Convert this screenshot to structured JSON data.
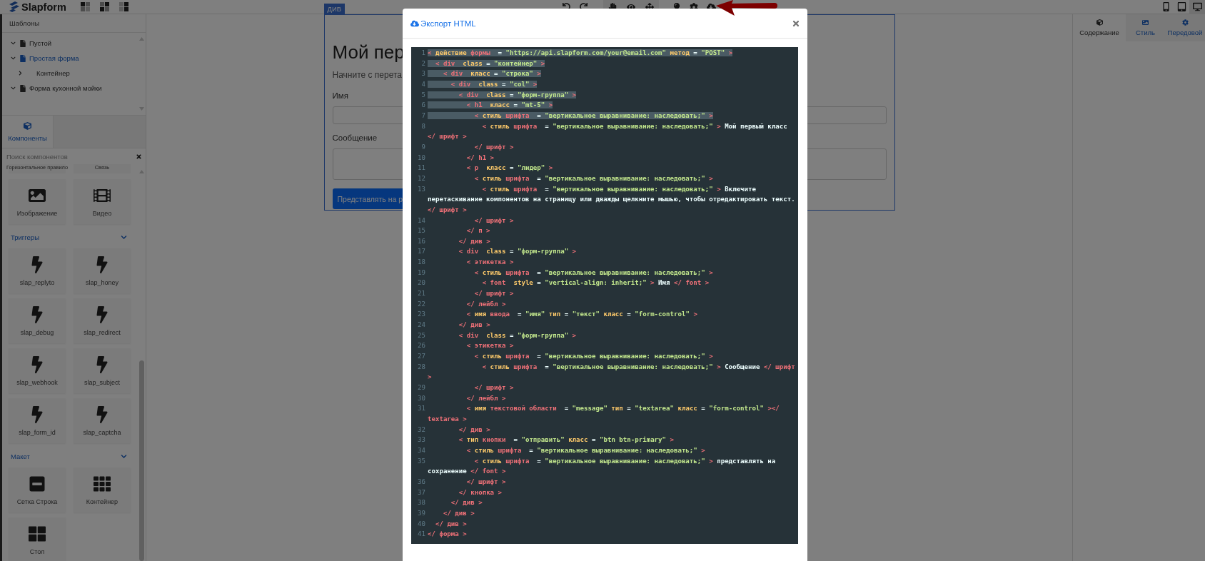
{
  "topbar": {
    "logo": "Slapform",
    "devices": [
      {
        "kind": "phone",
        "selected": false
      },
      {
        "kind": "tablet",
        "selected": false
      },
      {
        "kind": "desktop",
        "selected": true
      }
    ]
  },
  "sidebar": {
    "templates_title": "Шаблоны",
    "tree": [
      {
        "label": "Пустой",
        "expanded": true,
        "selected": false
      },
      {
        "label": "Простая форма",
        "expanded": true,
        "selected": true,
        "children": [
          {
            "label": "Контейнер",
            "expanded": false,
            "selected": false
          }
        ]
      },
      {
        "label": "Форма кухонной мойки",
        "expanded": true,
        "selected": false
      }
    ],
    "tabs": [
      {
        "label": "Компоненты",
        "selected": true
      }
    ],
    "search": {
      "placeholder": "Поиск компонентов"
    },
    "cut_blocks": [
      "Горизонтальное правило",
      "Связь"
    ],
    "blocks": [
      {
        "kind": "image",
        "label": "Изображение"
      },
      {
        "kind": "video",
        "label": "Видео"
      }
    ],
    "categories": [
      {
        "title": "Триггеры",
        "expanded": true,
        "blocks": [
          {
            "kind": "trigger",
            "label": "slap_replyto"
          },
          {
            "kind": "trigger",
            "label": "slap_honey"
          },
          {
            "kind": "trigger",
            "label": "slap_debug"
          },
          {
            "kind": "trigger",
            "label": "slap_redirect"
          },
          {
            "kind": "trigger",
            "label": "slap_webhook"
          },
          {
            "kind": "trigger",
            "label": "slap_subject"
          },
          {
            "kind": "trigger",
            "label": "slap_form_id"
          },
          {
            "kind": "trigger",
            "label": "slap_captcha"
          }
        ]
      },
      {
        "title": "Макет",
        "expanded": true,
        "blocks": [
          {
            "kind": "row",
            "label": "Сетка Строка"
          },
          {
            "kind": "grid",
            "label": "Контейнер"
          },
          {
            "kind": "table",
            "label": "Стол"
          }
        ]
      }
    ]
  },
  "canvas": {
    "badge": "ДИВ",
    "heading": "Мой пер",
    "lead": "Начните с перета",
    "fields": [
      {
        "kind": "input",
        "label": "Имя"
      },
      {
        "kind": "textarea",
        "label": "Сообщение"
      }
    ],
    "button": "Представлять на р"
  },
  "right_panel": {
    "tabs": [
      {
        "kind": "content",
        "label": "Содержание",
        "selected": true
      },
      {
        "kind": "style",
        "label": "Стиль",
        "selected": false
      },
      {
        "kind": "advanced",
        "label": "Передовой",
        "selected": false
      }
    ]
  },
  "modal": {
    "title": "Экспорт HTML",
    "code_lines": [
      {
        "number": "1",
        "highlighted": true,
        "tokens": [
          {
            "kind": "tag",
            "text": "< "
          },
          {
            "kind": "attr",
            "text": "действие"
          },
          {
            "kind": "tag",
            "text": " формы"
          },
          {
            "kind": "op",
            "text": "  = "
          },
          {
            "kind": "str",
            "text": "\"https://api.slapform.com/your@email.com\""
          },
          {
            "kind": "attr",
            "text": " метод"
          },
          {
            "kind": "op",
            "text": " = "
          },
          {
            "kind": "str",
            "text": "\"POST\""
          },
          {
            "kind": "tag",
            "text": " >"
          }
        ]
      },
      {
        "number": "2",
        "highlighted": true,
        "tokens": [
          {
            "kind": "tag",
            "text": "  < div"
          },
          {
            "kind": "attr",
            "text": "  class"
          },
          {
            "kind": "op",
            "text": " = "
          },
          {
            "kind": "str",
            "text": "\"контейнер\""
          },
          {
            "kind": "tag",
            "text": " >"
          }
        ]
      },
      {
        "number": "3",
        "highlighted": true,
        "tokens": [
          {
            "kind": "tag",
            "text": "    < div"
          },
          {
            "kind": "attr",
            "text": "  класс"
          },
          {
            "kind": "op",
            "text": " = "
          },
          {
            "kind": "str",
            "text": "\"строка\""
          },
          {
            "kind": "tag",
            "text": " >"
          }
        ]
      },
      {
        "number": "4",
        "highlighted": true,
        "tokens": [
          {
            "kind": "tag",
            "text": "      < div"
          },
          {
            "kind": "attr",
            "text": "  class"
          },
          {
            "kind": "op",
            "text": " = "
          },
          {
            "kind": "str",
            "text": "\"col\""
          },
          {
            "kind": "tag",
            "text": " >"
          }
        ]
      },
      {
        "number": "5",
        "highlighted": true,
        "tokens": [
          {
            "kind": "tag",
            "text": "        < div"
          },
          {
            "kind": "attr",
            "text": "  class"
          },
          {
            "kind": "op",
            "text": " = "
          },
          {
            "kind": "str",
            "text": "\"форм-группа\""
          },
          {
            "kind": "tag",
            "text": " >"
          }
        ]
      },
      {
        "number": "6",
        "highlighted": true,
        "tokens": [
          {
            "kind": "tag",
            "text": "          < h1"
          },
          {
            "kind": "attr",
            "text": "  класс"
          },
          {
            "kind": "op",
            "text": " = "
          },
          {
            "kind": "str",
            "text": "\"mt-5\""
          },
          {
            "kind": "tag",
            "text": " >"
          }
        ]
      },
      {
        "number": "7",
        "highlighted": true,
        "tokens": [
          {
            "kind": "tag",
            "text": "            < "
          },
          {
            "kind": "attr",
            "text": "стиль"
          },
          {
            "kind": "tag",
            "text": " шрифта"
          },
          {
            "kind": "op",
            "text": "  = "
          },
          {
            "kind": "str",
            "text": "\"вертикальное выравнивание: наследовать;\""
          },
          {
            "kind": "tag",
            "text": " >"
          }
        ]
      },
      {
        "number": "8",
        "highlighted": false,
        "tokens": [
          {
            "kind": "tag",
            "text": "              < "
          },
          {
            "kind": "attr",
            "text": "стиль"
          },
          {
            "kind": "tag",
            "text": " шрифта"
          },
          {
            "kind": "op",
            "text": "  = "
          },
          {
            "kind": "str",
            "text": "\"вертикальное выравнивание: наследовать;\""
          },
          {
            "kind": "tag",
            "text": " >"
          },
          {
            "kind": "text",
            "text": " Мой первый класс"
          },
          {
            "kind": "tag",
            "text": " </ шрифт >"
          }
        ]
      },
      {
        "number": "9",
        "highlighted": false,
        "tokens": [
          {
            "kind": "tag",
            "text": "            </ шрифт >"
          }
        ]
      },
      {
        "number": "10",
        "highlighted": false,
        "tokens": [
          {
            "kind": "tag",
            "text": "          </ h1 >"
          }
        ]
      },
      {
        "number": "11",
        "highlighted": false,
        "tokens": [
          {
            "kind": "tag",
            "text": "          < p"
          },
          {
            "kind": "attr",
            "text": "  класс"
          },
          {
            "kind": "op",
            "text": " = "
          },
          {
            "kind": "str",
            "text": "\"лидер\""
          },
          {
            "kind": "tag",
            "text": " >"
          }
        ]
      },
      {
        "number": "12",
        "highlighted": false,
        "tokens": [
          {
            "kind": "tag",
            "text": "            < "
          },
          {
            "kind": "attr",
            "text": "стиль"
          },
          {
            "kind": "tag",
            "text": " шрифта"
          },
          {
            "kind": "op",
            "text": "  = "
          },
          {
            "kind": "str",
            "text": "\"вертикальное выравнивание: наследовать;\""
          },
          {
            "kind": "tag",
            "text": " >"
          }
        ]
      },
      {
        "number": "13",
        "highlighted": false,
        "tokens": [
          {
            "kind": "tag",
            "text": "              < "
          },
          {
            "kind": "attr",
            "text": "стиль"
          },
          {
            "kind": "tag",
            "text": " шрифта"
          },
          {
            "kind": "op",
            "text": "  = "
          },
          {
            "kind": "str",
            "text": "\"вертикальное выравнивание: наследовать;\""
          },
          {
            "kind": "tag",
            "text": " >"
          },
          {
            "kind": "text",
            "text": " Включите перетаскивание компонентов на страницу или дважды щелкните мышью, чтобы отредактировать текст."
          },
          {
            "kind": "tag",
            "text": " </ шрифт >"
          }
        ]
      },
      {
        "number": "14",
        "highlighted": false,
        "tokens": [
          {
            "kind": "tag",
            "text": "            </ шрифт >"
          }
        ]
      },
      {
        "number": "15",
        "highlighted": false,
        "tokens": [
          {
            "kind": "tag",
            "text": "          </ п >"
          }
        ]
      },
      {
        "number": "16",
        "highlighted": false,
        "tokens": [
          {
            "kind": "tag",
            "text": "        </ див >"
          }
        ]
      },
      {
        "number": "17",
        "highlighted": false,
        "tokens": [
          {
            "kind": "tag",
            "text": "        < div"
          },
          {
            "kind": "attr",
            "text": "  class"
          },
          {
            "kind": "op",
            "text": " = "
          },
          {
            "kind": "str",
            "text": "\"форм-группа\""
          },
          {
            "kind": "tag",
            "text": " >"
          }
        ]
      },
      {
        "number": "18",
        "highlighted": false,
        "tokens": [
          {
            "kind": "tag",
            "text": "          < этикетка >"
          }
        ]
      },
      {
        "number": "19",
        "highlighted": false,
        "tokens": [
          {
            "kind": "tag",
            "text": "            < "
          },
          {
            "kind": "attr",
            "text": "стиль"
          },
          {
            "kind": "tag",
            "text": " шрифта"
          },
          {
            "kind": "op",
            "text": "  = "
          },
          {
            "kind": "str",
            "text": "\"вертикальное выравнивание: наследовать;\""
          },
          {
            "kind": "tag",
            "text": " >"
          }
        ]
      },
      {
        "number": "20",
        "highlighted": false,
        "tokens": [
          {
            "kind": "tag",
            "text": "              < font"
          },
          {
            "kind": "attr",
            "text": "  style"
          },
          {
            "kind": "op",
            "text": " = "
          },
          {
            "kind": "str",
            "text": "\"vertical-align: inherit;\""
          },
          {
            "kind": "tag",
            "text": " >"
          },
          {
            "kind": "text",
            "text": " Имя"
          },
          {
            "kind": "tag",
            "text": " </ font >"
          }
        ]
      },
      {
        "number": "21",
        "highlighted": false,
        "tokens": [
          {
            "kind": "tag",
            "text": "            </ шрифт >"
          }
        ]
      },
      {
        "number": "22",
        "highlighted": false,
        "tokens": [
          {
            "kind": "tag",
            "text": "          </ лейбл >"
          }
        ]
      },
      {
        "number": "23",
        "highlighted": false,
        "tokens": [
          {
            "kind": "tag",
            "text": "          < "
          },
          {
            "kind": "attr",
            "text": "имя"
          },
          {
            "kind": "tag",
            "text": " ввода"
          },
          {
            "kind": "op",
            "text": "  = "
          },
          {
            "kind": "str",
            "text": "\"имя\""
          },
          {
            "kind": "attr",
            "text": " тип"
          },
          {
            "kind": "op",
            "text": " = "
          },
          {
            "kind": "str",
            "text": "\"текст\""
          },
          {
            "kind": "attr",
            "text": " класс"
          },
          {
            "kind": "op",
            "text": " = "
          },
          {
            "kind": "str",
            "text": "\"form-control\""
          },
          {
            "kind": "tag",
            "text": " >"
          }
        ]
      },
      {
        "number": "24",
        "highlighted": false,
        "tokens": [
          {
            "kind": "tag",
            "text": "        </ див >"
          }
        ]
      },
      {
        "number": "25",
        "highlighted": false,
        "tokens": [
          {
            "kind": "tag",
            "text": "        < div"
          },
          {
            "kind": "attr",
            "text": "  class"
          },
          {
            "kind": "op",
            "text": " = "
          },
          {
            "kind": "str",
            "text": "\"форм-группа\""
          },
          {
            "kind": "tag",
            "text": " >"
          }
        ]
      },
      {
        "number": "26",
        "highlighted": false,
        "tokens": [
          {
            "kind": "tag",
            "text": "          < этикетка >"
          }
        ]
      },
      {
        "number": "27",
        "highlighted": false,
        "tokens": [
          {
            "kind": "tag",
            "text": "            < "
          },
          {
            "kind": "attr",
            "text": "стиль"
          },
          {
            "kind": "tag",
            "text": " шрифта"
          },
          {
            "kind": "op",
            "text": "  = "
          },
          {
            "kind": "str",
            "text": "\"вертикальное выравнивание: наследовать;\""
          },
          {
            "kind": "tag",
            "text": " >"
          }
        ]
      },
      {
        "number": "28",
        "highlighted": false,
        "tokens": [
          {
            "kind": "tag",
            "text": "              < "
          },
          {
            "kind": "attr",
            "text": "стиль"
          },
          {
            "kind": "tag",
            "text": " шрифта"
          },
          {
            "kind": "op",
            "text": "  = "
          },
          {
            "kind": "str",
            "text": "\"вертикальное выравнивание: наследовать;\""
          },
          {
            "kind": "tag",
            "text": " >"
          },
          {
            "kind": "text",
            "text": " Сообщение"
          },
          {
            "kind": "tag",
            "text": " </ шрифт >"
          }
        ]
      },
      {
        "number": "29",
        "highlighted": false,
        "tokens": [
          {
            "kind": "tag",
            "text": "            </ шрифт >"
          }
        ]
      },
      {
        "number": "30",
        "highlighted": false,
        "tokens": [
          {
            "kind": "tag",
            "text": "          </ лейбл >"
          }
        ]
      },
      {
        "number": "31",
        "highlighted": false,
        "tokens": [
          {
            "kind": "tag",
            "text": "          < "
          },
          {
            "kind": "attr",
            "text": "имя"
          },
          {
            "kind": "tag",
            "text": " текстовой области"
          },
          {
            "kind": "op",
            "text": "  = "
          },
          {
            "kind": "str",
            "text": "\"message\""
          },
          {
            "kind": "attr",
            "text": " тип"
          },
          {
            "kind": "op",
            "text": " = "
          },
          {
            "kind": "str",
            "text": "\"textarea\""
          },
          {
            "kind": "attr",
            "text": " класс"
          },
          {
            "kind": "op",
            "text": " = "
          },
          {
            "kind": "str",
            "text": "\"form-control\""
          },
          {
            "kind": "tag",
            "text": " ></ textarea >"
          }
        ]
      },
      {
        "number": "32",
        "highlighted": false,
        "tokens": [
          {
            "kind": "tag",
            "text": "        </ див >"
          }
        ]
      },
      {
        "number": "33",
        "highlighted": false,
        "tokens": [
          {
            "kind": "tag",
            "text": "        < "
          },
          {
            "kind": "attr",
            "text": "тип"
          },
          {
            "kind": "tag",
            "text": " кнопки"
          },
          {
            "kind": "op",
            "text": "  = "
          },
          {
            "kind": "str",
            "text": "\"отправить\""
          },
          {
            "kind": "attr",
            "text": " класс"
          },
          {
            "kind": "op",
            "text": " = "
          },
          {
            "kind": "str",
            "text": "\"btn btn-primary\""
          },
          {
            "kind": "tag",
            "text": " >"
          }
        ]
      },
      {
        "number": "34",
        "highlighted": false,
        "tokens": [
          {
            "kind": "tag",
            "text": "          < "
          },
          {
            "kind": "attr",
            "text": "стиль"
          },
          {
            "kind": "tag",
            "text": " шрифта"
          },
          {
            "kind": "op",
            "text": "  = "
          },
          {
            "kind": "str",
            "text": "\"вертикальное выравнивание: наследовать;\""
          },
          {
            "kind": "tag",
            "text": " >"
          }
        ]
      },
      {
        "number": "35",
        "highlighted": false,
        "tokens": [
          {
            "kind": "tag",
            "text": "            < "
          },
          {
            "kind": "attr",
            "text": "стиль"
          },
          {
            "kind": "tag",
            "text": " шрифта"
          },
          {
            "kind": "op",
            "text": "  = "
          },
          {
            "kind": "str",
            "text": "\"вертикальное выравнивание: наследовать;\""
          },
          {
            "kind": "tag",
            "text": " >"
          },
          {
            "kind": "text",
            "text": " представлять на сохранение"
          },
          {
            "kind": "tag",
            "text": " </ font >"
          }
        ]
      },
      {
        "number": "36",
        "highlighted": false,
        "tokens": [
          {
            "kind": "tag",
            "text": "          </ шрифт >"
          }
        ]
      },
      {
        "number": "37",
        "highlighted": false,
        "tokens": [
          {
            "kind": "tag",
            "text": "        </ кнопка >"
          }
        ]
      },
      {
        "number": "38",
        "highlighted": false,
        "tokens": [
          {
            "kind": "tag",
            "text": "      </ див >"
          }
        ]
      },
      {
        "number": "39",
        "highlighted": false,
        "tokens": [
          {
            "kind": "tag",
            "text": "    </ див >"
          }
        ]
      },
      {
        "number": "40",
        "highlighted": false,
        "tokens": [
          {
            "kind": "tag",
            "text": "  </ див >"
          }
        ]
      },
      {
        "number": "41",
        "highlighted": false,
        "tokens": [
          {
            "kind": "tag",
            "text": "</ форма >"
          }
        ]
      }
    ]
  }
}
